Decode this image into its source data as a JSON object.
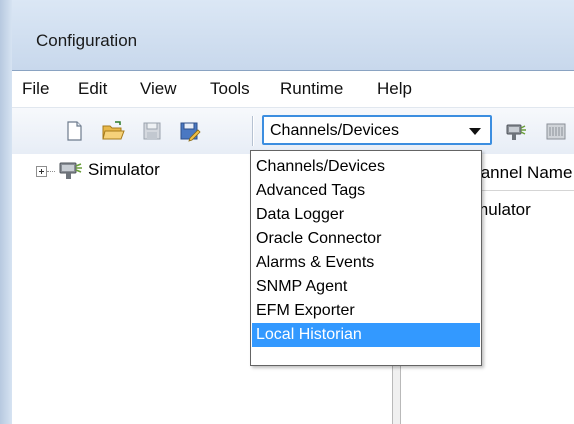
{
  "window": {
    "title": "Configuration"
  },
  "menu": {
    "file": "File",
    "edit": "Edit",
    "view": "View",
    "tools": "Tools",
    "runtime": "Runtime",
    "help": "Help"
  },
  "toolbar": {
    "buttons": [
      "new-document-icon",
      "open-folder-icon",
      "save-icon",
      "save-as-icon",
      "channel-icon",
      "devices-icon"
    ],
    "combo": {
      "selected": "Channels/Devices"
    }
  },
  "dropdown": {
    "items": [
      "Channels/Devices",
      "Advanced Tags",
      "Data Logger",
      "Oracle Connector",
      "Alarms & Events",
      "SNMP Agent",
      "EFM Exporter",
      "Local Historian"
    ],
    "highlighted_index": 7
  },
  "tree": {
    "nodes": [
      {
        "label": "Simulator",
        "icon": "channel-icon",
        "expanded": false
      }
    ]
  },
  "list": {
    "header": "Channel Name",
    "rows": [
      "Simulator"
    ]
  },
  "colors": {
    "accent": "#3399ff",
    "combo_border": "#3c8ee0",
    "titlebar": "#c8d8ec"
  }
}
